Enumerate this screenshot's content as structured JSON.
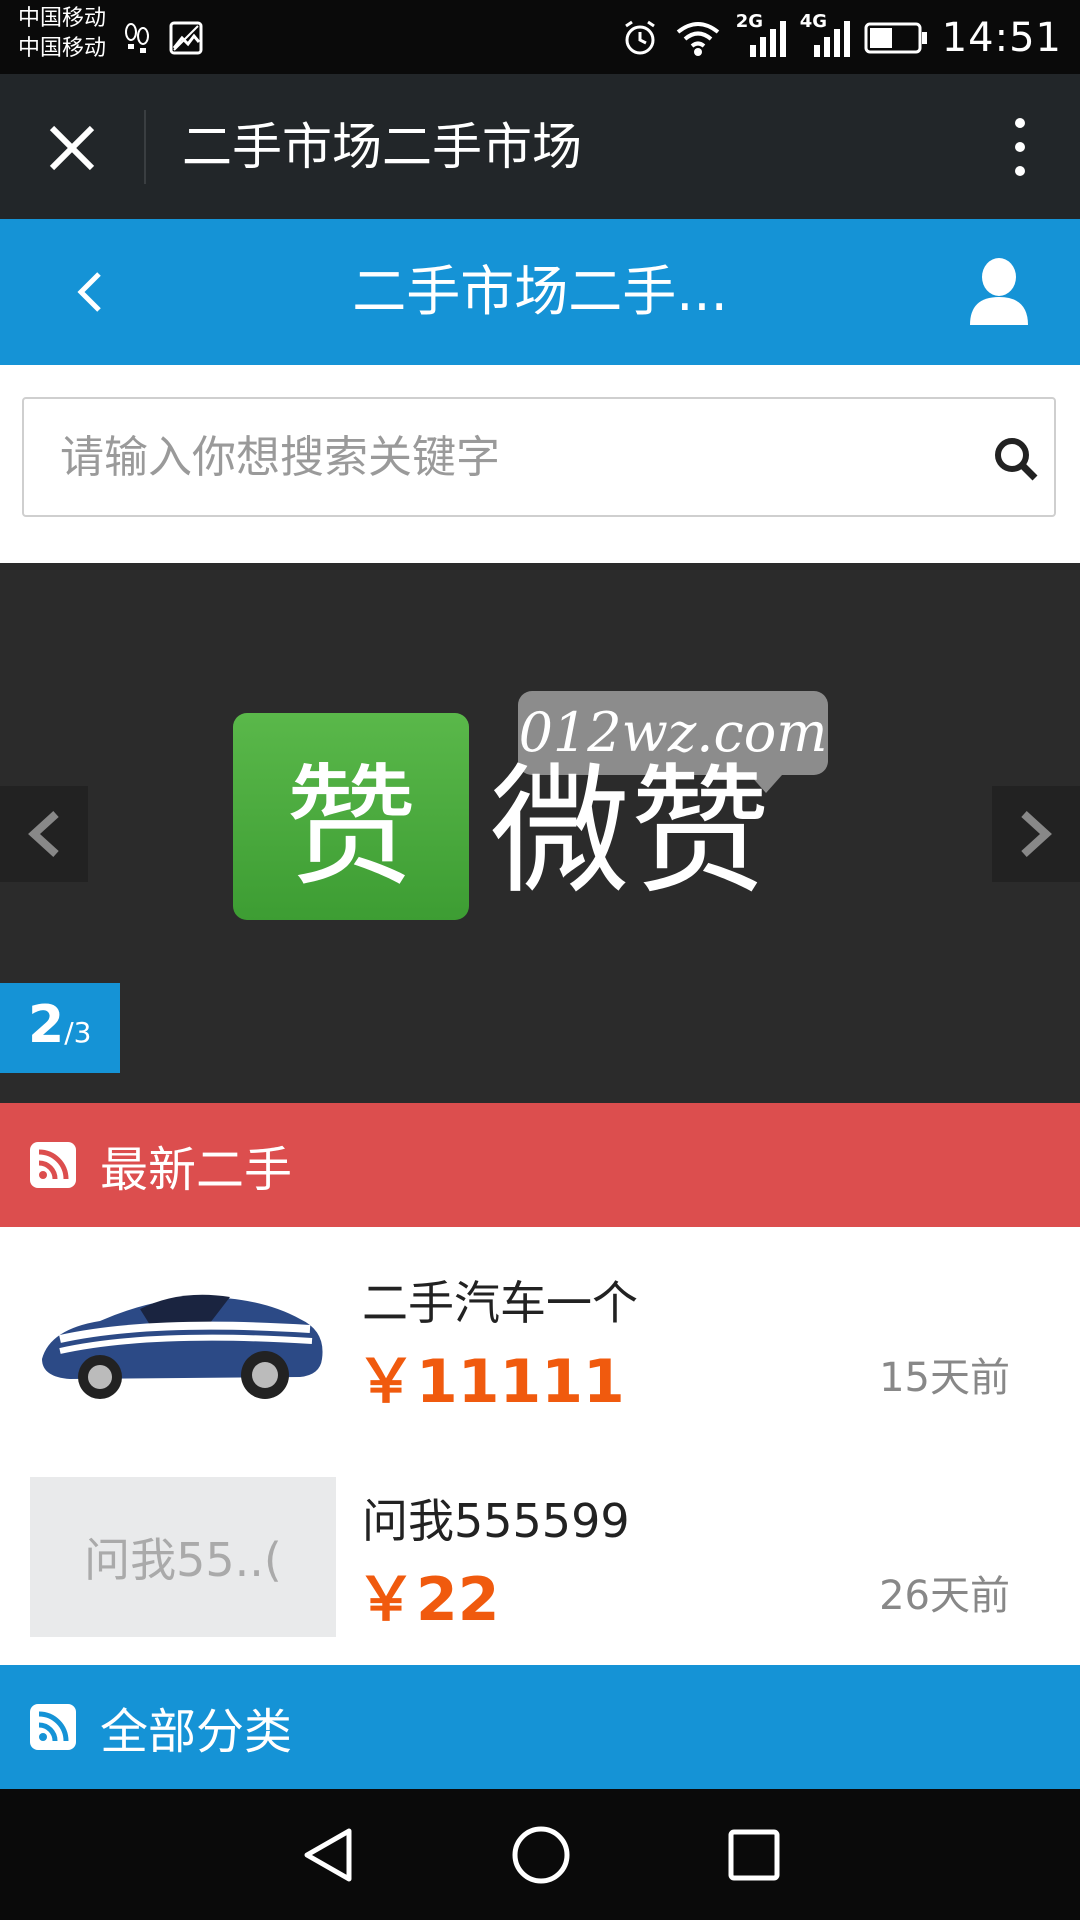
{
  "status_bar": {
    "carrier1": "中国移动",
    "carrier2": "中国移动",
    "network_2g": "2G",
    "network_4g": "4G",
    "time": "14:51"
  },
  "wechat_header": {
    "title": "二手市场二手市场"
  },
  "app_header": {
    "title": "二手市场二手..."
  },
  "search": {
    "placeholder": "请输入你想搜索关键字"
  },
  "banner": {
    "logo_char": "赞",
    "logo_text": "微赞",
    "bubble_text": "012wz.com",
    "current": "2",
    "total": "/3"
  },
  "latest_section": {
    "title": "最新二手"
  },
  "listings": [
    {
      "title": "二手汽车一个",
      "price": "￥11111",
      "time": "15天前",
      "thumb_type": "car-image"
    },
    {
      "title": "问我555599",
      "price": "￥22",
      "time": "26天前",
      "thumb_text": "问我55..("
    }
  ],
  "categories_section": {
    "title": "全部分类"
  },
  "colors": {
    "wechat_header": "#222629",
    "app_blue": "#1593d6",
    "section_red": "#dc4e4e",
    "price_orange": "#f05a0e"
  }
}
